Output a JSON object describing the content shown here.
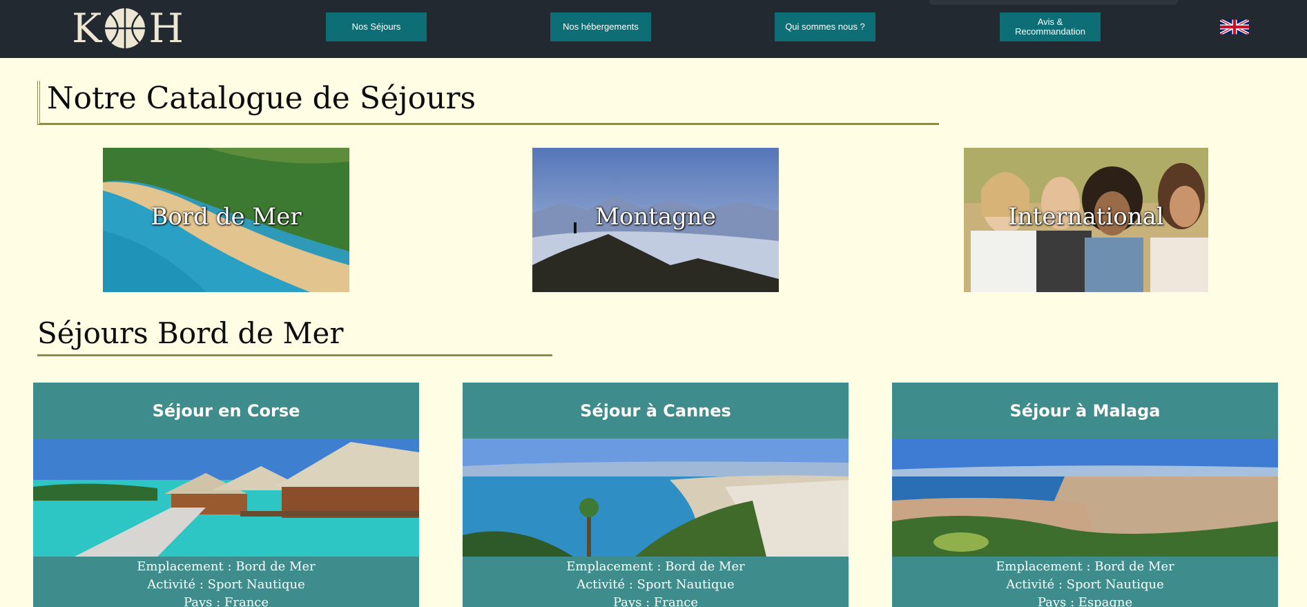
{
  "header": {
    "logo": {
      "left": "K",
      "right": "H",
      "icon": "basketball-icon"
    },
    "nav": [
      {
        "label": "Nos Séjours"
      },
      {
        "label": "Nos hébergements"
      },
      {
        "label": "Qui sommes nous ?"
      },
      {
        "label": "Avis &\nRecommandation"
      }
    ],
    "language_icon": "uk-flag-icon"
  },
  "catalog": {
    "title": "Notre Catalogue de Séjours",
    "categories": [
      {
        "label": "Bord de Mer"
      },
      {
        "label": "Montagne"
      },
      {
        "label": "International"
      }
    ]
  },
  "section": {
    "title": "Séjours Bord de Mer",
    "cards": [
      {
        "title": "Séjour en Corse",
        "location": "Emplacement : Bord de Mer",
        "activity": "Activité : Sport Nautique",
        "country": "Pays : France"
      },
      {
        "title": "Séjour à Cannes",
        "location": "Emplacement : Bord de Mer",
        "activity": "Activité : Sport Nautique",
        "country": "Pays : France"
      },
      {
        "title": "Séjour à Malaga",
        "location": "Emplacement : Bord de Mer",
        "activity": "Activité : Sport Nautique",
        "country": "Pays : Espagne"
      }
    ]
  },
  "colors": {
    "header_bg": "#232931",
    "nav_button": "#0e6e75",
    "page_bg": "#fffee4",
    "card_bg": "#3f8c8d",
    "accent_line": "#8f8a4c"
  }
}
